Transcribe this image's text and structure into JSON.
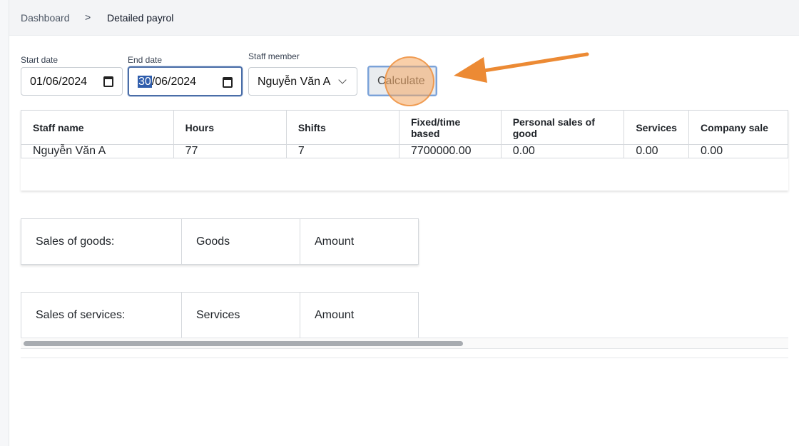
{
  "breadcrumb": {
    "home": "Dashboard",
    "separator": ">",
    "current": "Detailed payrol"
  },
  "filters": {
    "start_label": "Start date",
    "start_value": "01/06/2024",
    "end_label": "End date",
    "end_day_selected": "30",
    "end_rest": "/06/2024",
    "staff_label": "Staff member",
    "staff_value": "Nguyễn Văn A",
    "calculate_label": "Calculate"
  },
  "payroll_table": {
    "headers": [
      "Staff name",
      "Hours",
      "Shifts",
      "Fixed/time based",
      "Personal sales of good",
      "Services",
      "Company sale"
    ],
    "row": [
      "Nguyễn Văn A",
      "77",
      "7",
      "7700000.00",
      "0.00",
      "0.00",
      "0.00"
    ]
  },
  "goods_table": {
    "label": "Sales of goods:",
    "col1": "Goods",
    "col2": "Amount"
  },
  "services_table": {
    "label": "Sales of services:",
    "col1": "Services",
    "col2": "Amount"
  },
  "colors": {
    "accent_arrow": "#ec8a34",
    "focus_border": "#4a6da7"
  }
}
